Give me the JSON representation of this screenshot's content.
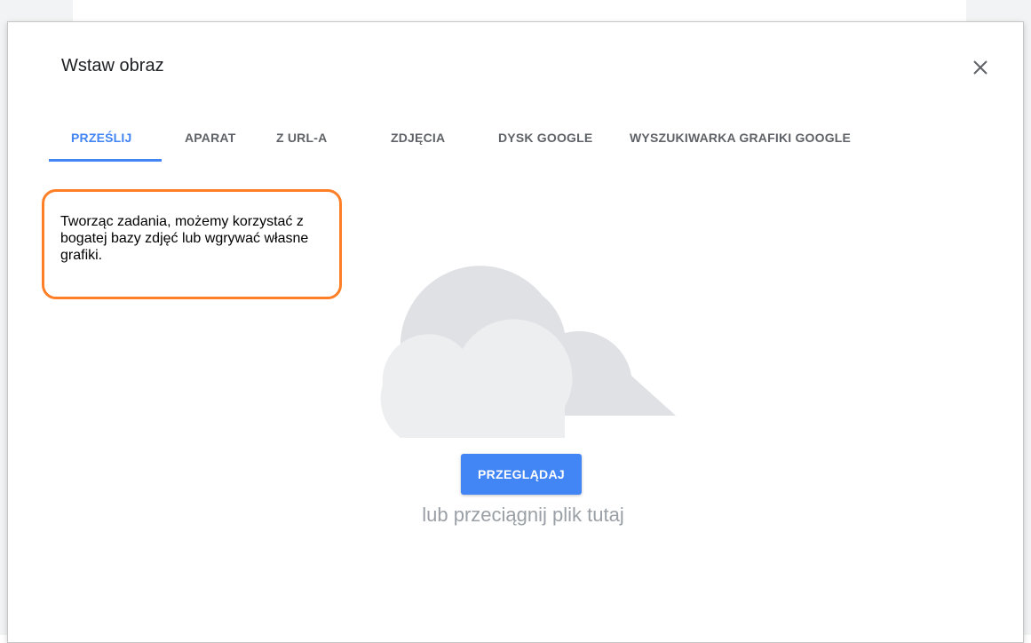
{
  "dialog": {
    "title": "Wstaw obraz",
    "close_icon": "close-icon"
  },
  "tabs": [
    {
      "label": "PRZEŚLIJ",
      "active": true
    },
    {
      "label": "APARAT",
      "active": false
    },
    {
      "label": "Z URL-A",
      "active": false
    },
    {
      "label": "ZDJĘCIA",
      "active": false
    },
    {
      "label": "DYSK GOOGLE",
      "active": false
    },
    {
      "label": "WYSZUKIWARKA GRAFIKI GOOGLE",
      "active": false
    }
  ],
  "callout": {
    "text": "Tworząc zadania, możemy korzystać z bogatej bazy zdjęć lub wgrywać własne grafiki."
  },
  "upload": {
    "browse_label": "PRZEGLĄDAJ",
    "drop_hint": "lub przeciągnij plik tutaj",
    "illustration_icon": "cloud-icon"
  },
  "colors": {
    "accent": "#4285f4",
    "callout_border": "#ff7f27",
    "cloud_back": "#dfe1e5",
    "cloud_front": "#eceef0"
  }
}
